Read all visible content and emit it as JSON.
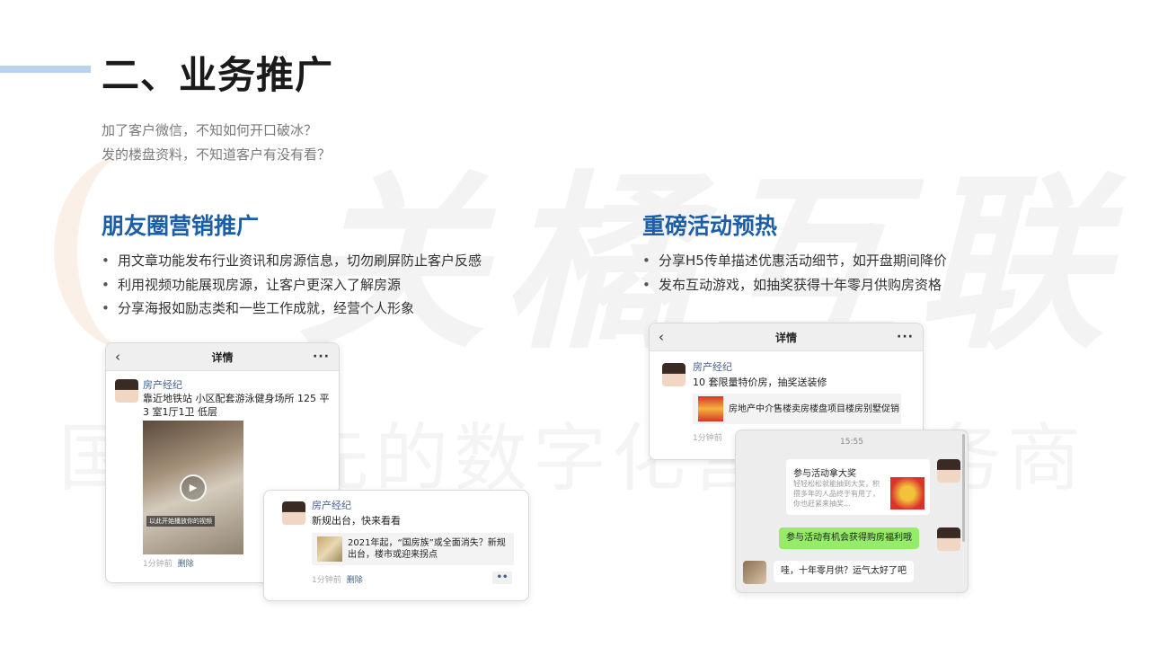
{
  "slide": {
    "title": "二、业务推广",
    "intro": [
      "加了客户微信，不知如何开口破冰？",
      "发的楼盘资料，不知道客户有没有看？"
    ],
    "watermark": {
      "brand": "关橘互联",
      "slogan": "国内领先的数字化营销服务商"
    }
  },
  "left_section": {
    "title": "朋友圈营销推广",
    "bullets": [
      "用文章功能发布行业资讯和房源信息，切勿刷屏防止客户反感",
      "利用视频功能展现房源，让客户更深入了解房源",
      "分享海报如励志类和一些工作成就，经营个人形象"
    ]
  },
  "right_section": {
    "title": "重磅活动预热",
    "bullets": [
      "分享H5传单描述优惠活动细节，如开盘期间降价",
      "发布互动游戏，如抽奖获得十年零月供购房资格"
    ]
  },
  "moments_card_1": {
    "header_title": "详情",
    "back_icon": "‹",
    "more_icon": "···",
    "poster_name": "房产经纪",
    "text": "靠近地铁站 小区配套游泳健身场所 125 平 3 室1厅1卫 低层",
    "video_caption": "以此开始播放你的视频",
    "time": "1分钟前",
    "delete_label": "删除"
  },
  "moments_card_2": {
    "poster_name": "房产经纪",
    "text": "新规出台，快来看看",
    "link_text": "2021年起，“国房族”或全面消失？新规出台，楼市或迎来拐点",
    "time": "1分钟前",
    "delete_label": "删除",
    "dots": "••"
  },
  "activity_card": {
    "header_title": "详情",
    "back_icon": "‹",
    "more_icon": "···",
    "poster_name": "房产经纪",
    "text": "10 套限量特价房，抽奖送装修",
    "link_text": "房地产中介售楼卖房楼盘项目楼房别墅促销",
    "time": "1分钟前"
  },
  "chat_card": {
    "time": "15:55",
    "card_title": "参与活动拿大奖",
    "card_desc": "轻轻松松就能抽到大奖，积攒多年的人品终于有用了，你也赶紧来抽奖...",
    "green_message": "参与活动有机会获得购房福利哦",
    "reply_message": "哇，十年零月供？运气太好了吧"
  },
  "colors": {
    "title_blue": "#1d5fa6",
    "accent_line": "#b9d3ee",
    "chat_green": "#95ec69",
    "link_name": "#49628c"
  }
}
